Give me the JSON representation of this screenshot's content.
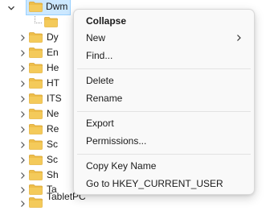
{
  "tree": {
    "selected_node": "Dwm",
    "child_labels": [
      "Dy",
      "En",
      "He",
      "HT",
      "ITS",
      "Ne",
      "Re",
      "Sc",
      "Sc",
      "Sh",
      "Ta",
      "TabletPC"
    ]
  },
  "context_menu": {
    "items": {
      "collapse": "Collapse",
      "new": "New",
      "find": "Find...",
      "delete": "Delete",
      "rename": "Rename",
      "export": "Export",
      "permissions": "Permissions...",
      "copy_key_name": "Copy Key Name",
      "go_to": "Go to HKEY_CURRENT_USER"
    }
  },
  "colors": {
    "folder": "#e9b63f",
    "selection": "#cce8ff",
    "menu_bg": "#f9f9f9"
  }
}
